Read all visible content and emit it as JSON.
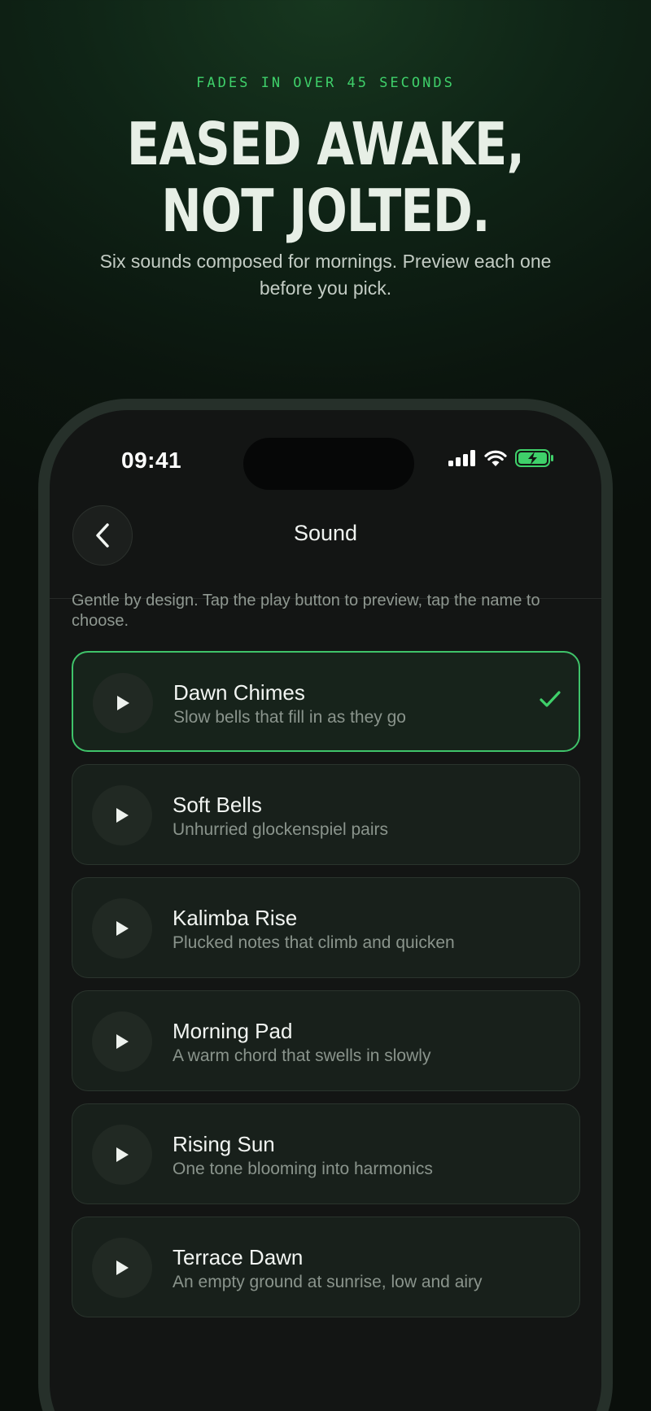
{
  "hero": {
    "eyebrow": "FADES IN OVER 45 SECONDS",
    "headline_line1": "EASED AWAKE,",
    "headline_line2": "NOT JOLTED.",
    "subhead": "Six sounds composed for mornings. Preview each one before you pick."
  },
  "status_bar": {
    "time": "09:41",
    "icons": [
      "signal-icon",
      "wifi-icon",
      "battery-charging-icon"
    ]
  },
  "screen": {
    "title": "Sound",
    "back_icon": "chevron-left-icon",
    "intro": "Gentle by design. Tap the play button to preview, tap the name to choose."
  },
  "sounds": [
    {
      "name": "Dawn Chimes",
      "description": "Slow bells that fill in as they go",
      "selected": true
    },
    {
      "name": "Soft Bells",
      "description": "Unhurried glockenspiel pairs",
      "selected": false
    },
    {
      "name": "Kalimba Rise",
      "description": "Plucked notes that climb and quicken",
      "selected": false
    },
    {
      "name": "Morning Pad",
      "description": "A warm chord that swells in slowly",
      "selected": false
    },
    {
      "name": "Rising Sun",
      "description": "One tone blooming into harmonics",
      "selected": false
    },
    {
      "name": "Terrace Dawn",
      "description": "An empty ground at sunrise, low and airy",
      "selected": false
    }
  ],
  "colors": {
    "accent": "#3fd06a",
    "selected_border": "#3fc36a",
    "background": "#0a0f0b",
    "card": "#18201b"
  }
}
